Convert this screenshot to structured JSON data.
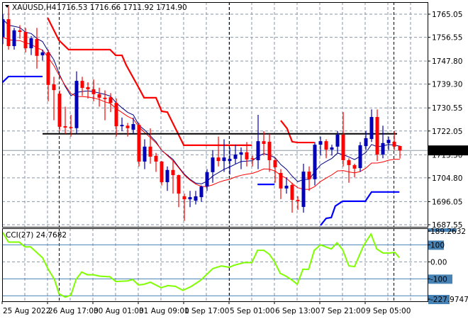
{
  "header": {
    "symbol": "XAUUSD,H4",
    "ohlc": "1716.53 1716.66 1711.92 1714.90"
  },
  "current_price": "1714.90",
  "cci": {
    "label": "CCI(27) 24.7682",
    "axis_labels": [
      "189.2632",
      "100",
      "0.00",
      "-100",
      "-227.9747"
    ]
  },
  "colors": {
    "bull": "#0000b8",
    "bear": "#ff0000",
    "ma_navy": "#000080",
    "ma_red": "#ff0000",
    "resistance": "#ff0000",
    "support": "#0000ff",
    "cci_line": "#7fff00",
    "level_line": "#4682b4",
    "grid": "#8a96a8",
    "hline": "#000000"
  },
  "chart_data": {
    "type": "candlestick",
    "title": "XAUUSD,H4",
    "price_range": [
      1687.55,
      1765.05
    ],
    "price_ticks": [
      "1765.05",
      "1756.55",
      "1747.80",
      "1739.30",
      "1730.55",
      "1722.05",
      "1713.30",
      "1704.80",
      "1696.05",
      "1687.55"
    ],
    "time_labels": [
      {
        "candle": 0,
        "label": "25 Aug 2022"
      },
      {
        "candle": 8,
        "label": "26 Aug 17:00"
      },
      {
        "candle": 16,
        "label": "30 Aug 01:00"
      },
      {
        "candle": 24,
        "label": "31 Aug 09:00"
      },
      {
        "candle": 32,
        "label": "1 Sep 17:00"
      },
      {
        "candle": 40,
        "label": "5 Sep 01:00"
      },
      {
        "candle": 48,
        "label": "6 Sep 13:00"
      },
      {
        "candle": 56,
        "label": "7 Sep 21:00"
      },
      {
        "candle": 64,
        "label": "9 Sep 05:00"
      }
    ],
    "period_separators": [
      10,
      40,
      69
    ],
    "ohlc": [
      [
        1756.7,
        1765,
        1754,
        1763.2
      ],
      [
        1763.2,
        1768,
        1752,
        1753.3
      ],
      [
        1753.3,
        1760,
        1752,
        1759.1
      ],
      [
        1759.1,
        1761,
        1756,
        1758.5
      ],
      [
        1758.5,
        1760,
        1751,
        1752.5
      ],
      [
        1752.5,
        1757,
        1750,
        1756.2
      ],
      [
        1755.9,
        1760,
        1745,
        1749.7
      ],
      [
        1749.9,
        1752,
        1748,
        1751.0
      ],
      [
        1751.0,
        1752,
        1733,
        1739.0
      ],
      [
        1739.2,
        1742,
        1726,
        1737.1
      ],
      [
        1735.8,
        1737,
        1722,
        1723.6
      ],
      [
        1723.8,
        1731,
        1721,
        1723.3
      ],
      [
        1723.5,
        1728,
        1720,
        1723.1
      ],
      [
        1723.1,
        1744,
        1721,
        1740.5
      ],
      [
        1740.5,
        1742,
        1735,
        1737.9
      ],
      [
        1738.2,
        1740,
        1734,
        1737.4
      ],
      [
        1737.4,
        1741,
        1733,
        1735.6
      ],
      [
        1735.6,
        1738,
        1731,
        1734.3
      ],
      [
        1734.3,
        1737,
        1726,
        1733.8
      ],
      [
        1734.5,
        1736,
        1729,
        1732.4
      ],
      [
        1732.4,
        1734,
        1720,
        1723.8
      ],
      [
        1723.8,
        1727,
        1722,
        1724.3
      ],
      [
        1724.0,
        1725,
        1720,
        1723.1
      ],
      [
        1722.5,
        1727,
        1721,
        1724.6
      ],
      [
        1724.3,
        1725,
        1709,
        1710.8
      ],
      [
        1710.8,
        1719,
        1708,
        1716.3
      ],
      [
        1716.3,
        1723,
        1710,
        1712.6
      ],
      [
        1712.9,
        1714,
        1707,
        1710.8
      ],
      [
        1710.8,
        1711,
        1702,
        1703.2
      ],
      [
        1703.2,
        1709,
        1700,
        1707.7
      ],
      [
        1707.7,
        1711,
        1699,
        1705.8
      ],
      [
        1705.8,
        1706,
        1694,
        1699.0
      ],
      [
        1698.0,
        1699,
        1689,
        1696.9
      ],
      [
        1696.9,
        1700,
        1694,
        1697.7
      ],
      [
        1696.4,
        1700,
        1695,
        1698.0
      ],
      [
        1697.7,
        1702,
        1696,
        1701.6
      ],
      [
        1701.6,
        1708,
        1700,
        1706.9
      ],
      [
        1706.9,
        1715,
        1703,
        1712.3
      ],
      [
        1712.3,
        1720,
        1709,
        1711.0
      ],
      [
        1711.0,
        1719,
        1707,
        1712.3
      ],
      [
        1711.0,
        1716,
        1706,
        1711.8
      ],
      [
        1711.8,
        1717,
        1710,
        1713.4
      ],
      [
        1713.4,
        1716,
        1708,
        1714.2
      ],
      [
        1714.2,
        1718,
        1709,
        1711.6
      ],
      [
        1712.0,
        1713,
        1709,
        1711.6
      ],
      [
        1711.3,
        1728,
        1708,
        1718.3
      ],
      [
        1718.3,
        1722,
        1713,
        1717.3
      ],
      [
        1718.1,
        1721,
        1707,
        1711.3
      ],
      [
        1711.3,
        1712,
        1703,
        1708.7
      ],
      [
        1706.6,
        1708,
        1697,
        1700.9
      ],
      [
        1700.9,
        1705,
        1699,
        1701.9
      ],
      [
        1702.2,
        1703,
        1692,
        1696.7
      ],
      [
        1696.7,
        1698,
        1693,
        1696.2
      ],
      [
        1694.1,
        1710,
        1692,
        1707.1
      ],
      [
        1707.1,
        1709,
        1700,
        1704.3
      ],
      [
        1704.3,
        1718,
        1702,
        1717.0
      ],
      [
        1717.0,
        1720,
        1713,
        1718.3
      ],
      [
        1718.3,
        1719,
        1712,
        1715.2
      ],
      [
        1715.2,
        1717,
        1713,
        1716.0
      ],
      [
        1716.3,
        1722,
        1714,
        1720.7
      ],
      [
        1720.7,
        1729,
        1709,
        1711.3
      ],
      [
        1711.3,
        1712,
        1703,
        1709.5
      ],
      [
        1709.5,
        1710,
        1705,
        1708.2
      ],
      [
        1708.4,
        1718,
        1707,
        1716.8
      ],
      [
        1716.5,
        1722,
        1715,
        1719.4
      ],
      [
        1719.1,
        1730,
        1718,
        1727.2
      ],
      [
        1727.2,
        1730,
        1711,
        1713.4
      ],
      [
        1713.4,
        1724,
        1712,
        1717.6
      ],
      [
        1717.6,
        1720,
        1715,
        1718.8
      ],
      [
        1718.1,
        1722,
        1715,
        1716.3
      ],
      [
        1716.53,
        1716.66,
        1711.92,
        1714.9
      ]
    ],
    "resistance_steps": [
      [
        [
          7.9,
          1763.7
        ],
        [
          9.9,
          1755.4
        ],
        [
          11.6,
          1752.0
        ],
        [
          18.9,
          1752.0
        ],
        [
          19.9,
          1749.9
        ],
        [
          21,
          1749.9
        ],
        [
          21.75,
          1746.3
        ],
        [
          23.9,
          1738.2
        ],
        [
          24.9,
          1734.3
        ],
        [
          27,
          1734.3
        ],
        [
          28,
          1729.3
        ],
        [
          29,
          1729.0
        ],
        [
          31.9,
          1716.8
        ],
        [
          43.9,
          1716.8
        ]
      ],
      [
        [
          49,
          1725.9
        ],
        [
          50.1,
          1723.0
        ],
        [
          51,
          1718.1
        ],
        [
          52,
          1717.8
        ],
        [
          54.9,
          1717.8
        ]
      ]
    ],
    "support_steps": [
      [
        [
          -0.2,
          1739.7
        ],
        [
          1,
          1742.1
        ],
        [
          7,
          1742.1
        ]
      ],
      [
        [
          44.9,
          1702.4
        ],
        [
          47.9,
          1702.4
        ]
      ],
      [
        [
          56,
          1687.3
        ],
        [
          57,
          1689.9
        ],
        [
          57.9,
          1690.2
        ],
        [
          58.6,
          1694.4
        ],
        [
          59.9,
          1696.2
        ],
        [
          63.9,
          1696.2
        ],
        [
          65,
          1699.6
        ],
        [
          69.9,
          1699.6
        ]
      ]
    ],
    "horizontal_line": {
      "price": 1721.0,
      "from": 7,
      "to": 69.5
    },
    "cci_levels": [
      200,
      100,
      0,
      -100,
      -200
    ],
    "cci_range": [
      -227.9747,
      189.2632
    ],
    "cci_series": [
      [
        0,
        172
      ],
      [
        1,
        116
      ],
      [
        2.9,
        116
      ],
      [
        3.9,
        88
      ],
      [
        4.9,
        88
      ],
      [
        7,
        24
      ],
      [
        8,
        -44
      ],
      [
        9.1,
        -104
      ],
      [
        9.9,
        -188
      ],
      [
        11,
        -208
      ],
      [
        12,
        -196
      ],
      [
        12.9,
        -104
      ],
      [
        13.9,
        -60
      ],
      [
        14.9,
        -76
      ],
      [
        16,
        -76
      ],
      [
        17,
        -84
      ],
      [
        18.9,
        -88
      ],
      [
        19.9,
        -116
      ],
      [
        22,
        -112
      ],
      [
        22.9,
        -104
      ],
      [
        23.9,
        -136
      ],
      [
        24.9,
        -132
      ],
      [
        26,
        -120
      ],
      [
        27.9,
        -152
      ],
      [
        29.1,
        -140
      ],
      [
        30.4,
        -144
      ],
      [
        31.75,
        -168
      ],
      [
        33.25,
        -144
      ],
      [
        34.9,
        -108
      ],
      [
        37,
        -40
      ],
      [
        38.5,
        -24
      ],
      [
        39.9,
        -32
      ],
      [
        40.75,
        -20
      ],
      [
        42.6,
        -4
      ],
      [
        43.9,
        -4
      ],
      [
        44.9,
        68
      ],
      [
        46,
        68
      ],
      [
        47,
        44
      ],
      [
        47.9,
        0
      ],
      [
        48.9,
        -68
      ],
      [
        49.9,
        -84
      ],
      [
        51,
        -108
      ],
      [
        51.9,
        -132
      ],
      [
        52.9,
        -44
      ],
      [
        53.9,
        -44
      ],
      [
        54.9,
        68
      ],
      [
        56,
        100
      ],
      [
        57.9,
        76
      ],
      [
        58.9,
        112
      ],
      [
        59.9,
        72
      ],
      [
        61,
        -24
      ],
      [
        62,
        -28
      ],
      [
        63.6,
        96
      ],
      [
        64.9,
        164
      ],
      [
        65.9,
        76
      ],
      [
        67,
        52
      ],
      [
        68.25,
        52
      ],
      [
        69.1,
        56
      ],
      [
        69.9,
        24.77
      ]
    ]
  }
}
